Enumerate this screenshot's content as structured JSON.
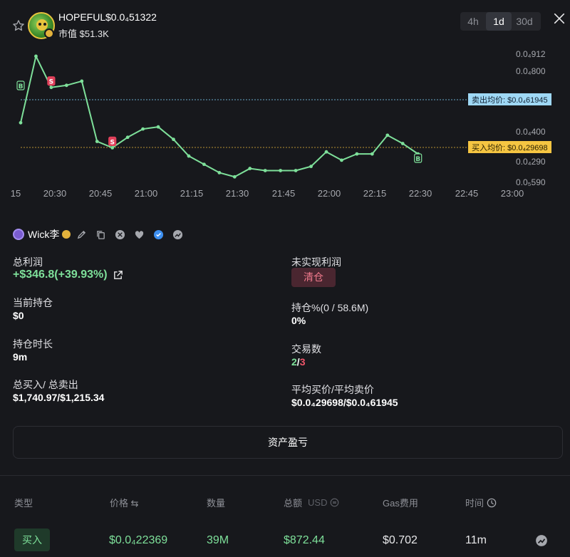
{
  "header": {
    "token_name": "HOPEFUL",
    "token_price": "$0.0₄51322",
    "market_cap": "市值 $51.3K",
    "timeframes": [
      "4h",
      "1d",
      "30d"
    ],
    "active_timeframe": "1d"
  },
  "chart_data": {
    "type": "line",
    "color": "#7ee09a",
    "x_tick_labels": [
      "15",
      "20:30",
      "20:45",
      "21:00",
      "21:15",
      "21:30",
      "21:45",
      "22:00",
      "22:15",
      "22:30",
      "22:45",
      "23:00"
    ],
    "y_tick_labels": [
      "0.0₄912",
      "0.0₄800",
      "0.0₄400",
      "0.0₄290",
      "0.0₅590"
    ],
    "ylim": [
      5.9e-06,
      9.5e-06
    ],
    "values": [
      5.9e-06,
      9.1e-06,
      7.6e-06,
      7.7e-06,
      7.9e-06,
      5e-06,
      4.7e-06,
      5.2e-06,
      5.6e-06,
      5.7e-06,
      5.1e-06,
      4.3e-06,
      3.9e-06,
      3.5e-06,
      3.3e-06,
      3.7e-06,
      3.6e-06,
      3.6e-06,
      3.6e-06,
      3.8e-06,
      4.5e-06,
      4.1e-06,
      4.4e-06,
      4.4e-06,
      5.3e-06,
      4.9e-06,
      4.4e-06
    ],
    "markers": [
      {
        "label": "B",
        "kind": "buy",
        "index": 0
      },
      {
        "label": "S",
        "kind": "sell",
        "index": 2
      },
      {
        "label": "S",
        "kind": "sell",
        "index": 6
      },
      {
        "label": "B",
        "kind": "buy",
        "index": 26
      }
    ],
    "sell_avg_label": "卖出均价: $0.0₄61945",
    "buy_avg_label": "买入均价: $0.0₄29698",
    "sell_avg_value": 6.1945e-06,
    "buy_avg_value": 2.9698e-06,
    "grid": false,
    "colors": {
      "sell": "#9fd8f5",
      "buy": "#f5c542"
    }
  },
  "user": {
    "name": "Wick李"
  },
  "stats": {
    "total_pnl_label": "总利润",
    "total_pnl_value": "+$346.8(+39.93%)",
    "unrealized_label": "未实现利润",
    "clear_label": "清仓",
    "holding_label": "当前持仓",
    "holding_value": "$0",
    "holding_pct_label": "持仓%(0 / 58.6M)",
    "holding_pct_value": "0%",
    "duration_label": "持仓时长",
    "duration_value": "9m",
    "trades_label": "交易数",
    "trades_buy": "2",
    "trades_sep": "/",
    "trades_sell": "3",
    "total_buysell_label": "总买入/ 总卖出",
    "total_buysell_value": "$1,740.97/$1,215.34",
    "avg_price_label": "平均买价/平均卖价",
    "avg_price_value": "$0.0₄29698/$0.0₄61945"
  },
  "asset_button": "资产盈亏",
  "table": {
    "headers": {
      "type": "类型",
      "price": "价格 ⇆",
      "amount": "数量",
      "total": "总额",
      "total_unit": "USD",
      "gas": "Gas费用",
      "time": "时间"
    },
    "rows": [
      {
        "type": "买入",
        "price": "$0.0₄22369",
        "amount": "39M",
        "total": "$872.44",
        "gas": "$0.702",
        "time": "11m"
      }
    ]
  }
}
